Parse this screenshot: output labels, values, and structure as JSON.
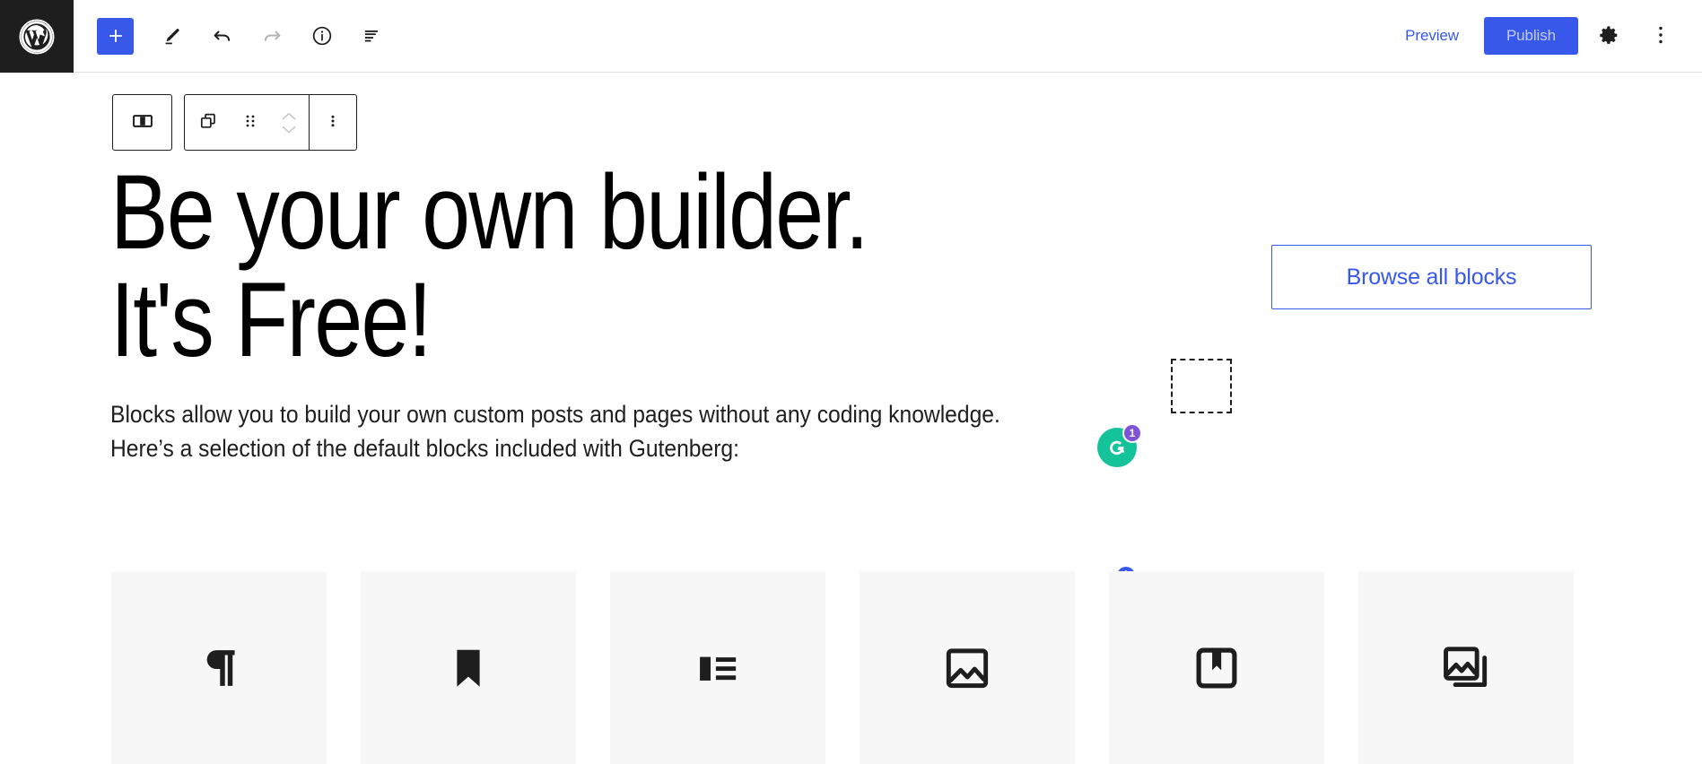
{
  "app": {
    "name": "WordPress Block Editor",
    "logo_icon": "wordpress-logo-icon"
  },
  "toolbar": {
    "add_block_label": "+",
    "add_block_icon": "plus-icon",
    "tools_icon": "pencil-edit-icon",
    "undo_icon": "undo-arrow-icon",
    "redo_icon": "redo-arrow-icon",
    "details_icon": "info-circle-icon",
    "list_view_icon": "list-view-icon",
    "preview_label": "Preview",
    "publish_label": "Publish",
    "settings_icon": "gear-icon",
    "options_icon": "more-vertical-icon"
  },
  "block_toolbar": {
    "block_type_icon": "columns-block-icon",
    "duplicate_icon": "copy-blocks-icon",
    "drag_icon": "drag-handle-icon",
    "move_up_icon": "chevron-up-icon",
    "move_down_icon": "chevron-down-icon",
    "more_options_icon": "more-vertical-icon"
  },
  "editor": {
    "title": "Be your own builder. It's Free!",
    "paragraph": "Blocks allow you to build your own custom posts and pages without any coding knowledge. Here’s a selection of the default blocks included with Gutenberg:",
    "browse_all_blocks_label": "Browse all blocks",
    "mini_inserter_icon": "plus-circle-icon",
    "empty_placeholder_name": "dashed-block-placeholder"
  },
  "grammarly": {
    "icon": "grammarly-logo-icon",
    "badge_count": "1",
    "circle_color": "#15c39a",
    "badge_color": "#7f54d9"
  },
  "block_cards": [
    {
      "name": "paragraph",
      "icon": "paragraph-pilcrow-icon"
    },
    {
      "name": "heading",
      "icon": "bookmark-icon"
    },
    {
      "name": "quote",
      "icon": "quote-lines-icon"
    },
    {
      "name": "image",
      "icon": "image-icon"
    },
    {
      "name": "cover",
      "icon": "cover-book-icon"
    },
    {
      "name": "gallery",
      "icon": "gallery-stacked-image-icon"
    }
  ],
  "colors": {
    "accent": "#3858e9",
    "publish_text": "#c3cdf5",
    "logo_bg": "#1e1e1e",
    "card_bg": "#f7f7f7",
    "text": "#1e1e1e"
  }
}
